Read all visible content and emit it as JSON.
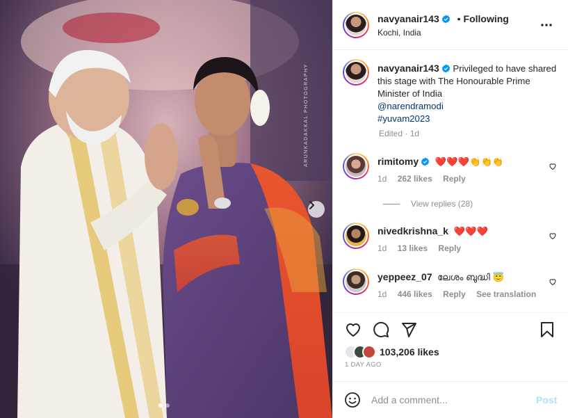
{
  "photo": {
    "watermark": "ARUNKADAKKAL PHOTOGRAPHY",
    "next_icon": "chevron-right-icon",
    "dots_count": 2,
    "active_dot": 0
  },
  "post_header": {
    "username": "navyanair143",
    "separator": "•",
    "follow_status": "Following",
    "location": "Kochi, India",
    "more_icon": "more-horizontal-icon"
  },
  "caption": {
    "username": "navyanair143",
    "text": "Privileged to have shared this stage with The Honourable Prime Minister of India",
    "mention": "@narendramodi",
    "hashtag": "#yuvam2023",
    "edited": "Edited",
    "separator": "·",
    "age": "1d"
  },
  "comments": [
    {
      "username": "rimitomy",
      "verified": true,
      "text": "❤️❤️❤️👏👏👏",
      "age": "1d",
      "likes": "262 likes",
      "reply": "Reply",
      "view_replies": "View replies (28)"
    },
    {
      "username": "nivedkrishna_k",
      "verified": false,
      "text": "❤️❤️❤️",
      "age": "1d",
      "likes": "13 likes",
      "reply": "Reply"
    },
    {
      "username": "yeppeez_07",
      "verified": false,
      "text": "ലേശം ബുദ്ധി 😇",
      "age": "1d",
      "likes": "446 likes",
      "reply": "Reply",
      "translation": "See translation"
    }
  ],
  "actions": {
    "like_icon": "heart-icon",
    "comment_icon": "comment-icon",
    "share_icon": "send-icon",
    "save_icon": "bookmark-icon",
    "likes_count": "103,206 likes",
    "post_age": "1 DAY AGO"
  },
  "add_comment": {
    "emoji_icon": "emoji-icon",
    "placeholder": "Add a comment...",
    "post_label": "Post"
  },
  "colors": {
    "verified_blue": "#0095f6",
    "link_blue": "#00376b",
    "muted": "#8e8e8e",
    "heart_red": "#ed4956",
    "post_disabled": "#b2dffc"
  }
}
